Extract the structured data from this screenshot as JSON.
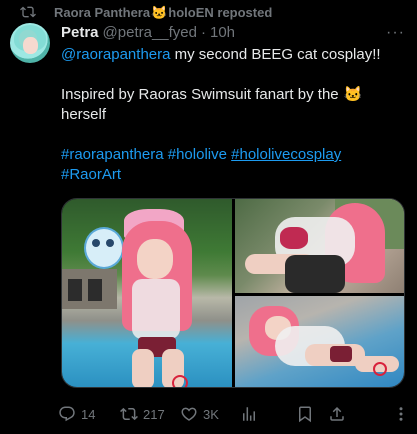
{
  "repost": {
    "icon": "repost-icon",
    "prefix": "Raora Panthera",
    "emoji": "🐱",
    "suffix": "holoEN reposted"
  },
  "author": {
    "name": "Petra",
    "handle": "@petra__fyed",
    "separator": "·",
    "time": "10h"
  },
  "more_label": "···",
  "text": {
    "mention": "@raorapanthera",
    "line1_rest": " my second BEEG cat cosplay!!",
    "line2_a": "Inspired by Raoras Swimsuit fanart by the ",
    "line2_emoji": "🐱",
    "line3": "herself",
    "hashtags": [
      "#raorapanthera",
      "#hololive",
      "#hololivecosplay",
      "#RaorArt"
    ]
  },
  "actions": {
    "replies": "14",
    "reposts": "217",
    "likes": "3K"
  },
  "colors": {
    "background": "#000000",
    "text": "#e7e9ea",
    "muted": "#71767b",
    "link": "#1d9bf0"
  }
}
